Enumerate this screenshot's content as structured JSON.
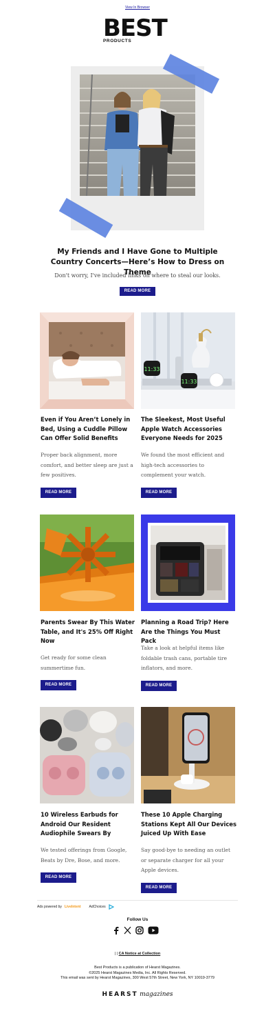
{
  "header": {
    "view_in_browser": "View In Browser",
    "logo_main": "BEST",
    "logo_sub": "PRODUCTS"
  },
  "hero": {
    "title": "My Friends and I Have Gone to Multiple Country Concerts—Here’s How to Dress on Theme",
    "description": "Don't worry, I've included links on where to steal our looks.",
    "button": "READ MORE"
  },
  "cards": [
    {
      "title": "Even if You Aren’t Lonely in Bed, Using a Cuddle Pillow Can Offer Solid Benefits",
      "description": "Proper back alignment, more comfort, and better sleep are just a few positives.",
      "button": "READ MORE"
    },
    {
      "title": "The Sleekest, Most Useful Apple Watch Accessories Everyone Needs for 2025",
      "description": "We found the most efficient and high-tech accessories to complement your watch.",
      "button": "READ MORE",
      "watch_time": "11:33"
    },
    {
      "title": "Parents Swear By This Water Table, and It's 25% Off Right Now",
      "description": "Get ready for some clean summertime fun.",
      "button": "READ MORE"
    },
    {
      "title": "Planning a Road Trip? Here Are the Things You Must Pack",
      "description": "Take a look at helpful items like foldable trash cans, portable tire inflators, and more.",
      "button": "READ MORE"
    },
    {
      "title": "10 Wireless Earbuds for Android Our Resident Audiophile Swears By",
      "description": "We tested offerings from Google, Beats by Dre, Bose, and more.",
      "button": "READ MORE"
    },
    {
      "title": "These 10 Apple Charging Stations Kept All Our Devices Juiced Up With Ease",
      "description": "Say good-bye to needing an outlet or separate charger for all your Apple devices.",
      "button": "READ MORE"
    }
  ],
  "ads": {
    "powered_by": "Ads powered by",
    "liveintent": "LiveIntent",
    "adchoices": "AdChoices"
  },
  "footer": {
    "follow_us": "Follow Us",
    "socials": [
      "facebook-icon",
      "x-icon",
      "instagram-icon",
      "youtube-icon"
    ],
    "ca_prefix": "| |",
    "ca_notice": "CA Notice at Collection",
    "legal_1": "Best Products is a publication of Hearst Magazines.",
    "legal_2": "©2025 Hearst Magazines Media, Inc. All Rights Reserved.",
    "legal_3": "This email was sent by Hearst Magazines, 300 West 57th Street, New York, NY 10019-3779",
    "brand_bold": "HEARST",
    "brand_italic": "magazines"
  },
  "colors": {
    "button": "#1c1c8c",
    "tape": "#5b82e0",
    "pink_frame": "#f2d7cc",
    "blue_frame": "#3a3ae8"
  }
}
